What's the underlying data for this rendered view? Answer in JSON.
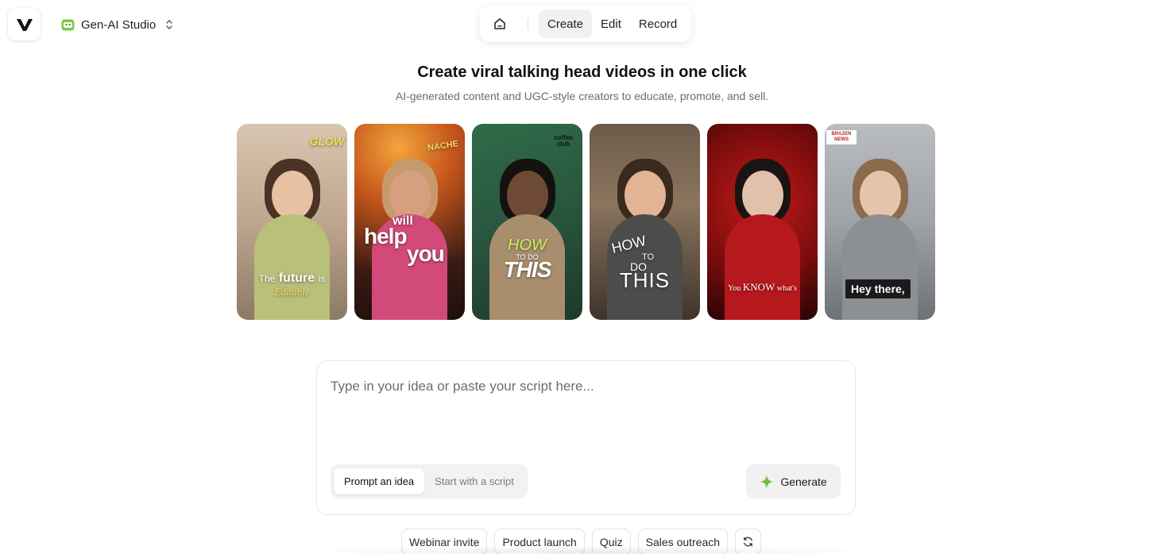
{
  "app": {
    "logo_icon": "brand-v-logo-icon",
    "workspace_name": "Gen-AI Studio",
    "workspace_icon": "robot-face-icon",
    "workspace_icon_color": "#7ac943"
  },
  "nav": {
    "home_icon": "home-icon",
    "tabs": [
      {
        "label": "Create",
        "active": true
      },
      {
        "label": "Edit",
        "active": false
      },
      {
        "label": "Record",
        "active": false
      }
    ]
  },
  "hero": {
    "title": "Create viral talking head videos in one click",
    "subtitle": "AI-generated content and UGC-style creators to educate, promote, and sell."
  },
  "gallery": {
    "cards": [
      {
        "caption_1": "The",
        "caption_2": "future",
        "caption_3": "is",
        "caption_4": "Editable",
        "logo": "GLOW"
      },
      {
        "caption_1": "will",
        "caption_2": "help",
        "caption_3": "you",
        "logo": "NACHE"
      },
      {
        "caption_1": "HOW",
        "caption_2": "TO DO",
        "caption_3": "THIS",
        "logo_1": "coffee",
        "logo_2": "club"
      },
      {
        "caption_1": "HOW",
        "caption_2": "TO",
        "caption_3": "DO",
        "caption_4": "THIS"
      },
      {
        "caption_1": "You",
        "caption_2": "KNOW",
        "caption_3": "what's"
      },
      {
        "caption_1": "Hey there,",
        "logo_1": "BRAZEN",
        "logo_2": "NEWS"
      }
    ]
  },
  "composer": {
    "placeholder": "Type in your idea or paste your script here...",
    "value": "",
    "modes": [
      {
        "label": "Prompt an idea",
        "active": true
      },
      {
        "label": "Start with a script",
        "active": false
      }
    ],
    "generate_label": "Generate",
    "generate_icon": "sparkle-icon",
    "accent_color": "#6cc04a"
  },
  "suggestions": {
    "items": [
      "Webinar invite",
      "Product launch",
      "Quiz",
      "Sales outreach"
    ],
    "refresh_icon": "refresh-icon"
  }
}
